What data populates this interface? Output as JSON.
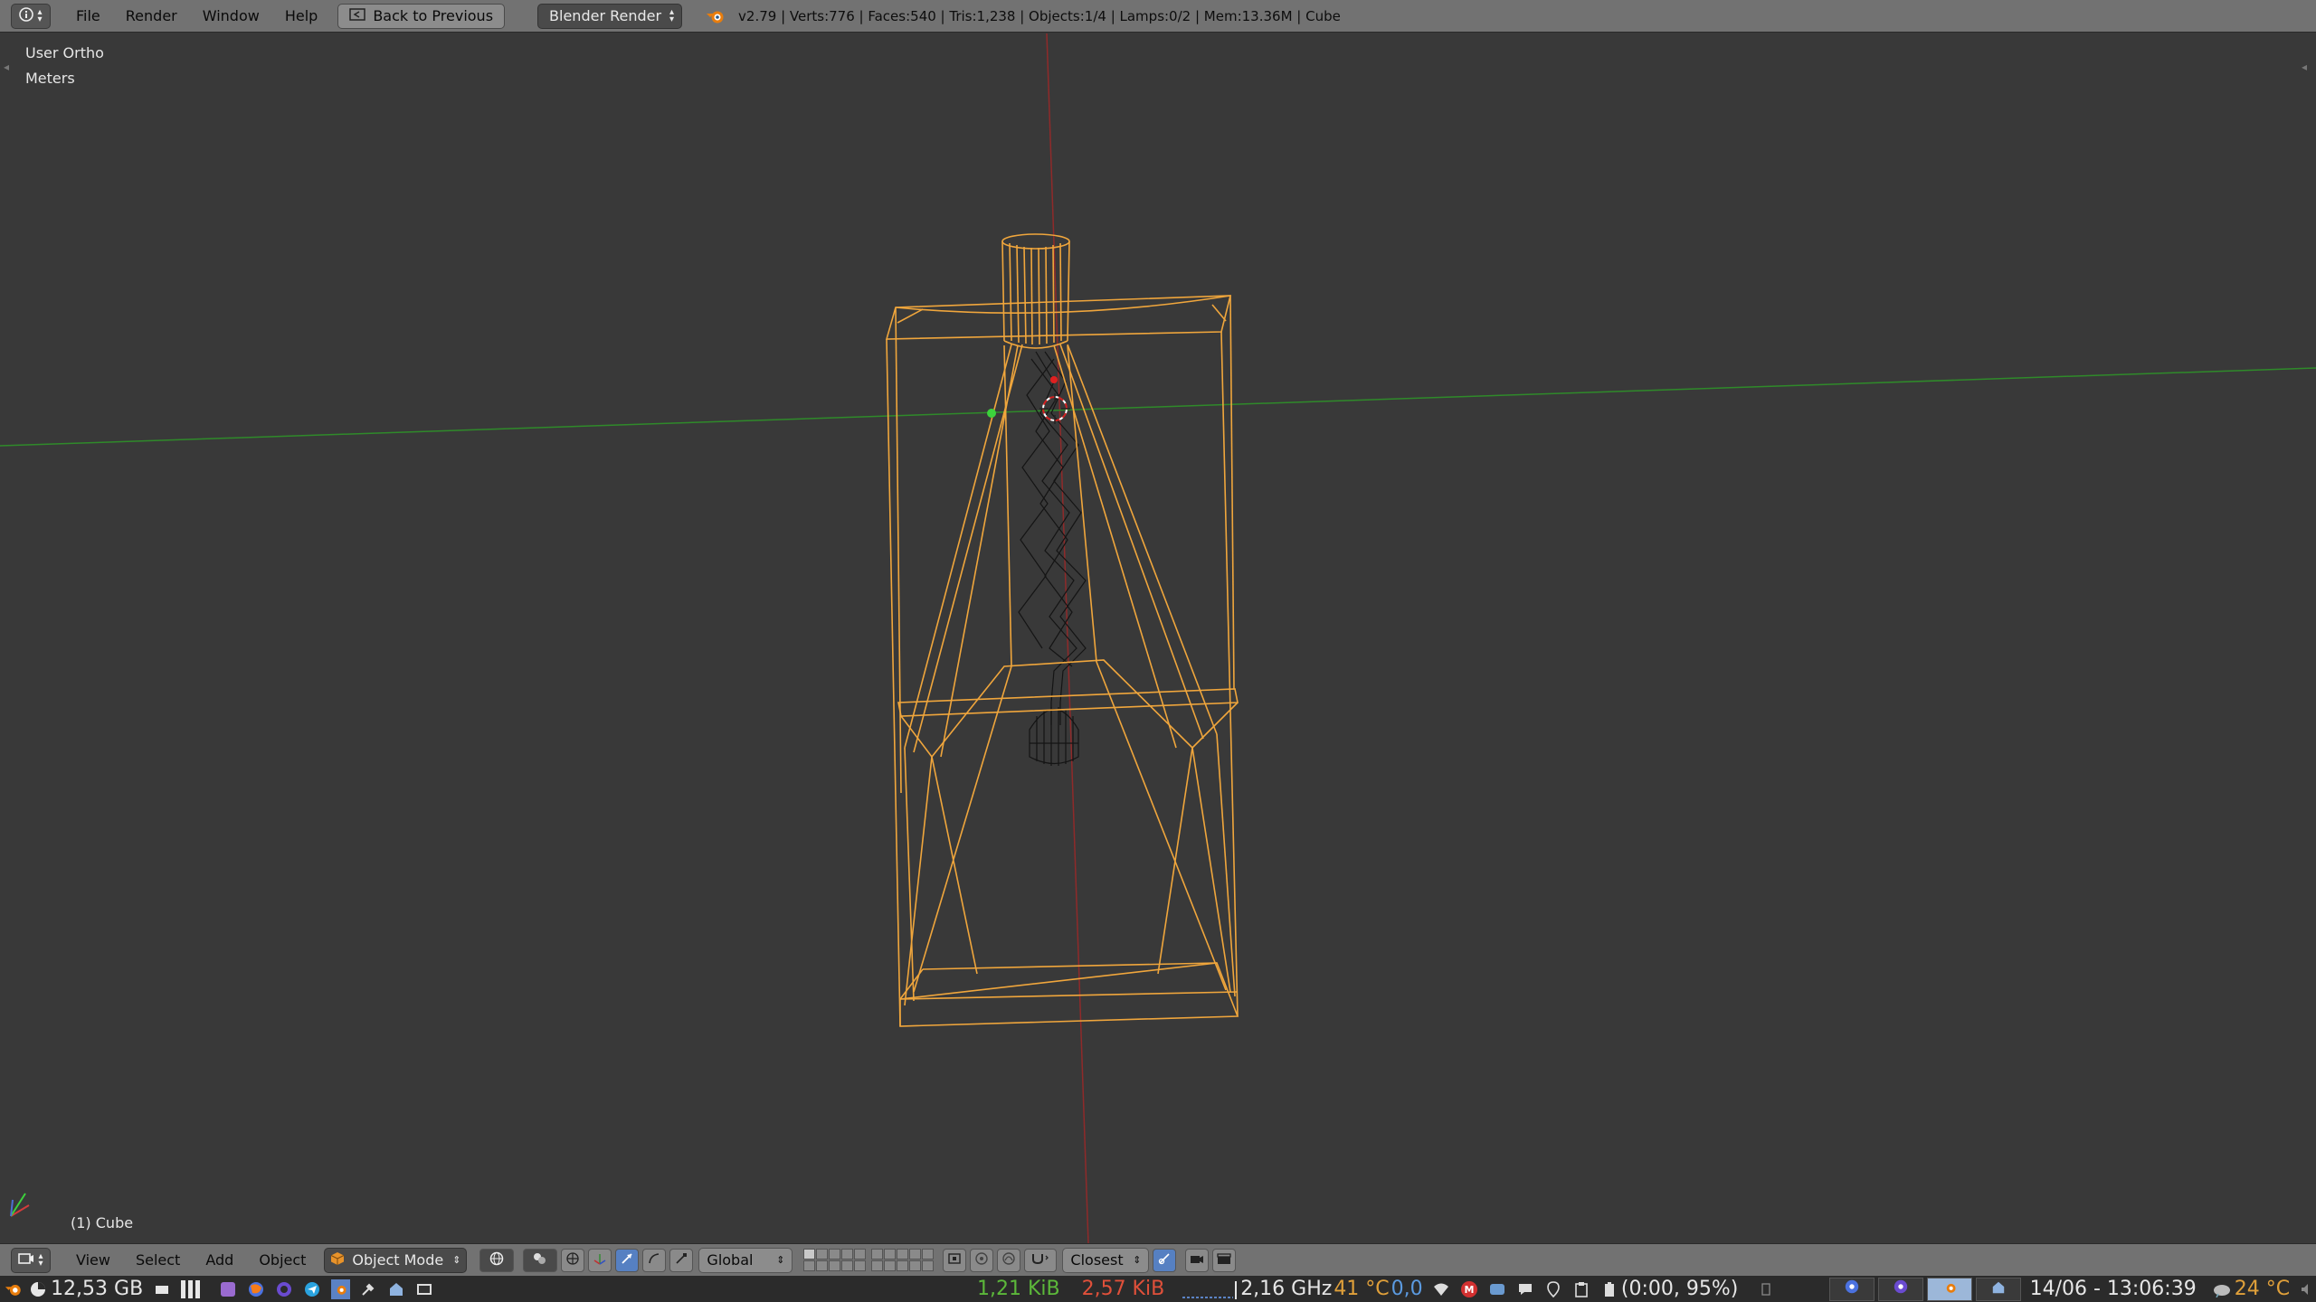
{
  "topbar": {
    "editor_icon": "info-icon",
    "menus": [
      "File",
      "Render",
      "Window",
      "Help"
    ],
    "back_button": "Back to Previous",
    "render_engine": "Blender Render",
    "stats": "v2.79 | Verts:776 | Faces:540 | Tris:1,238 | Objects:1/4 | Lamps:0/2 | Mem:13.36M | Cube"
  },
  "viewport": {
    "view_name": "User Ortho",
    "units": "Meters",
    "active_object": "(1) Cube"
  },
  "viewheader": {
    "menus": [
      "View",
      "Select",
      "Add",
      "Object"
    ],
    "mode": "Object Mode",
    "orientation": "Global",
    "snap_target": "Closest"
  },
  "taskbar": {
    "memory": "12,53 GB",
    "net_down": "1,21 KiB",
    "net_up": "2,57 KiB",
    "cpu_freq": "2,16 GHz",
    "cpu_temp": "41 °C",
    "load": "0,0",
    "battery": "(0:00, 95%)",
    "datetime": "14/06 - 13:06:39",
    "weather": "24 °C"
  },
  "colors": {
    "header_bg": "#727272",
    "viewport_bg": "#393939",
    "wire_selected": "#f0a63c",
    "wire_unselected": "#111111",
    "axis_x": "#a02828",
    "axis_y": "#3aa032",
    "taskbar_bg": "#2b2b2b",
    "accent_blue": "#5680c2"
  }
}
